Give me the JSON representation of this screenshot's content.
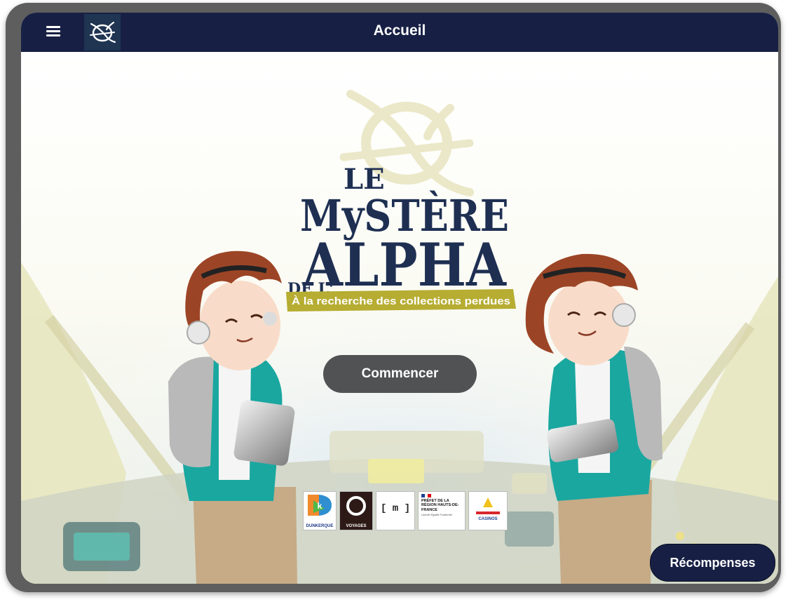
{
  "header": {
    "title": "Accueil",
    "menu_icon": "hamburger-menu-icon",
    "logo_icon": "alpha-logo-icon"
  },
  "hero": {
    "title_line_1": "LE",
    "title_line_2": "MySTÈRE",
    "title_line_3_prefix": "DE L'",
    "title_line_3": "ALPHA",
    "subtitle": "À la recherche des collections perdues"
  },
  "actions": {
    "start_label": "Commencer",
    "rewards_label": "Récompenses"
  },
  "partners": [
    {
      "name": "DUNKERQUE"
    },
    {
      "name": "VOYAGES"
    },
    {
      "name": "[ m ]"
    },
    {
      "name": "PRÉFET DE LA RÉGION HAUTS-DE-FRANCE",
      "motto": "Liberté Égalité Fraternité"
    },
    {
      "name": "CASINOS"
    }
  ],
  "colors": {
    "header_bg": "#172044",
    "title_navy": "#1e2f52",
    "subtitle_band": "#b6ad32",
    "jacket_teal": "#1aa7a0",
    "start_button": "#505254"
  }
}
